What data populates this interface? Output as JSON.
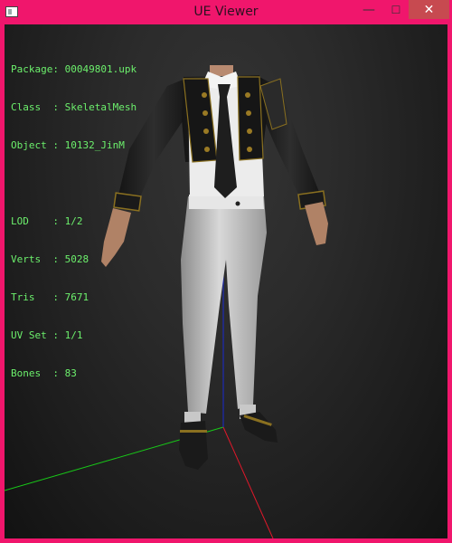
{
  "window": {
    "title": "UE Viewer",
    "close_symbol": "✕",
    "maximize_symbol": "☐",
    "minimize_symbol": "—"
  },
  "info": {
    "package": "Package: 00049801.upk",
    "class": "Class  : SkeletalMesh",
    "object": "Object : 10132_JinM",
    "lod": "LOD    : 1/2",
    "verts": "Verts  : 5028",
    "tris": "Tris   : 7671",
    "uvset": "UV Set : 1/1",
    "bones": "Bones  : 83"
  },
  "colors": {
    "frame": "#f0166c",
    "info_text": "#6cf06c",
    "axis_x": "#e0182a",
    "axis_y": "#18c818",
    "axis_z": "#1a2ad0"
  }
}
